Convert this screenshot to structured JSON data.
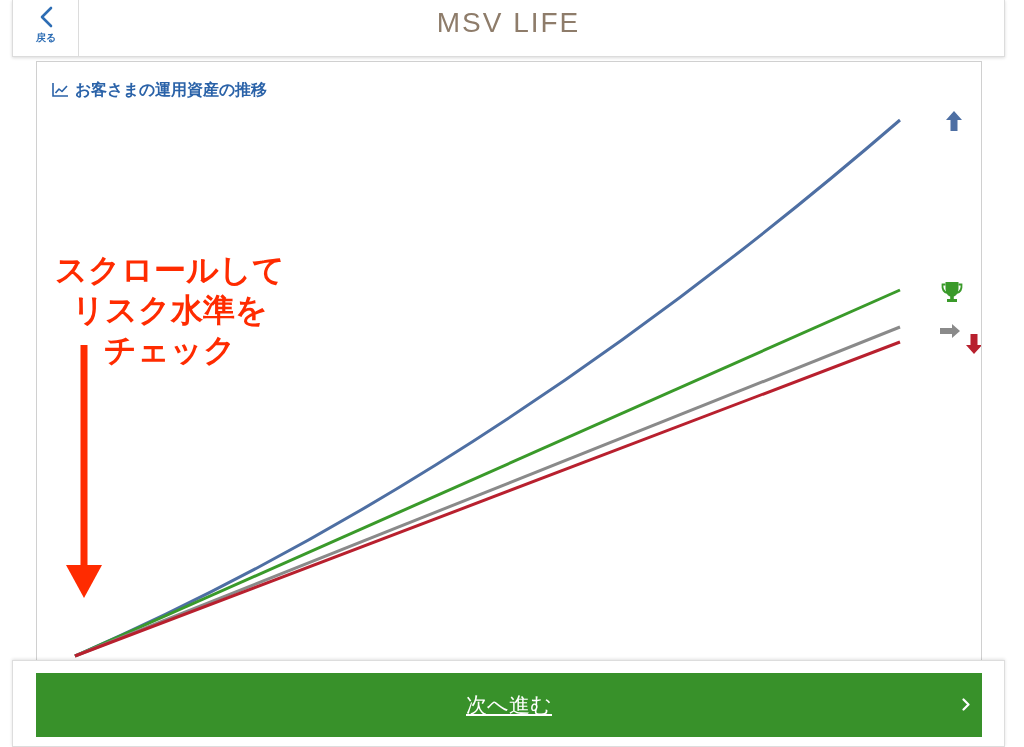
{
  "header": {
    "back_label": "戻る",
    "title": "MSV LIFE"
  },
  "chart_panel": {
    "title": "お客さまの運用資産の推移",
    "series": [
      {
        "kind": "up",
        "color": "#4e6fa3"
      },
      {
        "kind": "trophy",
        "color": "#3a9a2a"
      },
      {
        "kind": "right",
        "color": "#8a8a8a"
      },
      {
        "kind": "down",
        "color": "#b8202e"
      }
    ]
  },
  "annotation": {
    "text": "スクロールしてリスク水準をチェック"
  },
  "next_button": {
    "label": "次へ進む"
  }
}
